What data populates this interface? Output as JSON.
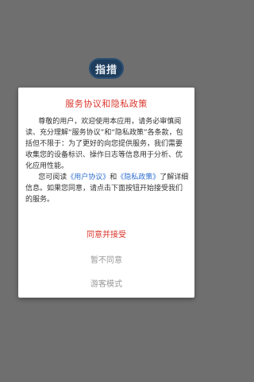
{
  "app": {
    "logo_text": "指措"
  },
  "dialog": {
    "title": "服务协议和隐私政策",
    "para1": "尊敬的用户，欢迎使用本应用，请务必审慎阅读、充分理解“服务协议”和“隐私政策”各条款，包括但不限于：为了更好的向您提供服务，我们需要收集您的设备标识、操作日志等信息用于分析、优化应用性能。",
    "para2_prefix": "您可阅读",
    "user_agreement_link": "《用户协议》",
    "para2_and": "和",
    "privacy_link": "《隐私政策》",
    "para2_suffix": "了解详细信息。如果您同意，请点击下面按钮开始接受我们的服务。"
  },
  "buttons": {
    "agree": "同意并接受",
    "disagree": "暂不同意",
    "guest": "游客模式"
  },
  "colors": {
    "accent": "#d9342b",
    "link": "#2f6fd0",
    "muted": "#999999",
    "overlay": "#6f6f6f"
  }
}
